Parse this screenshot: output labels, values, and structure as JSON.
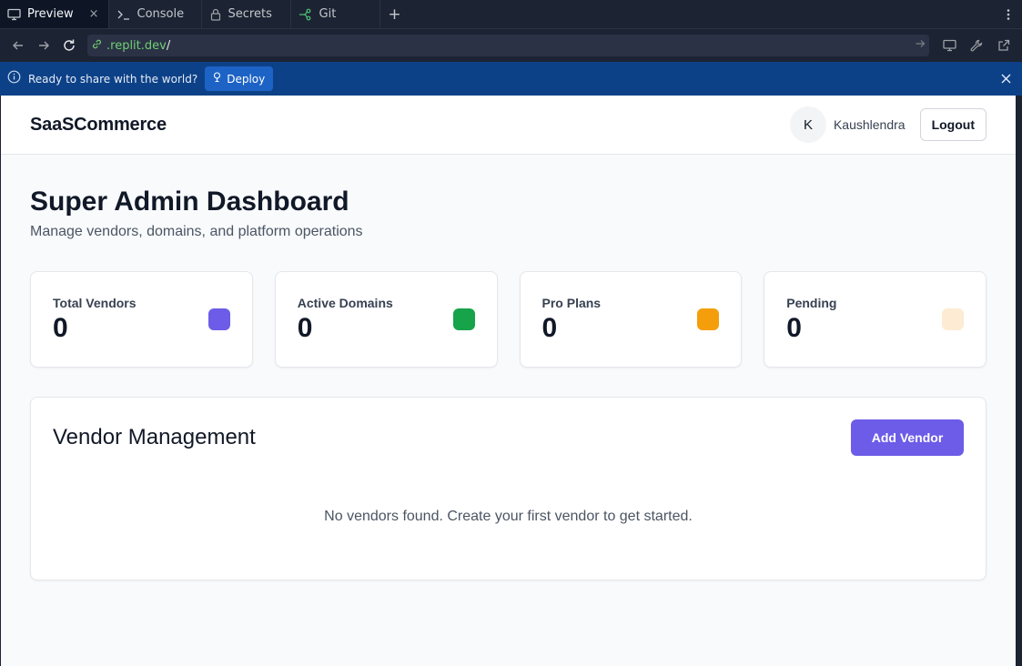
{
  "tabs": [
    {
      "label": "Preview",
      "icon": "monitor-icon",
      "active": true,
      "close": "×"
    },
    {
      "label": "Console",
      "icon": "terminal-icon"
    },
    {
      "label": "Secrets",
      "icon": "lock-icon"
    },
    {
      "label": "Git",
      "icon": "git-branch-icon"
    }
  ],
  "tabbar": {
    "add_label": "+"
  },
  "address": {
    "domain": ".replit.dev",
    "path": "/"
  },
  "banner": {
    "message": "Ready to share with the world?",
    "deploy_label": "Deploy"
  },
  "app": {
    "brand": "SaaSCommerce",
    "user": {
      "initial": "K",
      "name": "Kaushlendra"
    },
    "logout_label": "Logout",
    "title": "Super Admin Dashboard",
    "subtitle": "Manage vendors, domains, and platform operations",
    "stats": [
      {
        "label": "Total Vendors",
        "value": "0",
        "color": "#6c5ce7"
      },
      {
        "label": "Active Domains",
        "value": "0",
        "color": "#16a34a"
      },
      {
        "label": "Pro Plans",
        "value": "0",
        "color": "#f59e0b"
      },
      {
        "label": "Pending",
        "value": "0",
        "color": "#fdebd3"
      }
    ],
    "vendor_section": {
      "title": "Vendor Management",
      "add_label": "Add Vendor",
      "empty_message": "No vendors found. Create your first vendor to get started."
    }
  },
  "colors": {
    "accent": "#6c5ce7",
    "banner": "#0d4187",
    "deploy": "#1d63c5",
    "chrome": "#1c2333"
  }
}
